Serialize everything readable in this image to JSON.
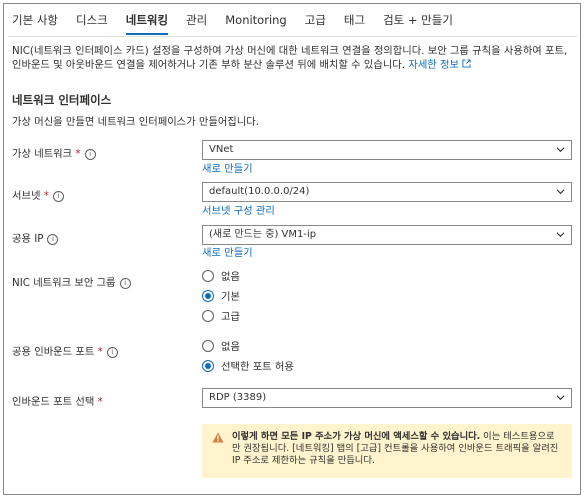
{
  "tabs": [
    "기본 사항",
    "디스크",
    "네트워킹",
    "관리",
    "Monitoring",
    "고급",
    "태그",
    "검토 + 만들기"
  ],
  "active_tab": "네트워킹",
  "description": {
    "text": "NIC(네트워크 인터페이스 카드) 설정을 구성하여 가상 머신에 대한 네트워크 연결을 정의합니다. 보안 그룹 규칙을 사용하여 포트, 인바운드 및 아웃바운드 연결을 제어하거나 기존 부하 분산 솔루션 뒤에 배치할 수 있습니다.",
    "link": "자세한 정보"
  },
  "section": {
    "title": "네트워크 인터페이스",
    "desc": "가상 머신을 만들면 네트워크 인터페이스가 만들어집니다."
  },
  "fields": {
    "vnet": {
      "label": "가상 네트워크",
      "value": "VNet",
      "link": "새로 만들기"
    },
    "subnet": {
      "label": "서브넷",
      "value": "default(10.0.0.0/24)",
      "link": "서브넷 구성 관리"
    },
    "public_ip": {
      "label": "공용 IP",
      "value": "(새로 만드는 중) VM1-ip",
      "link": "새로 만들기"
    },
    "nsg": {
      "label": "NIC 네트워크 보안 그룹",
      "options": [
        "없음",
        "기본",
        "고급"
      ],
      "selected": "기본"
    },
    "inbound_ports": {
      "label": "공용 인바운드 포트",
      "options": [
        "없음",
        "선택한 포트 허용"
      ],
      "selected": "선택한 포트 허용"
    },
    "select_ports": {
      "label": "인바운드 포트 선택",
      "value": "RDP (3389)"
    }
  },
  "required_mark": "*",
  "warning": {
    "bold": "이렇게 하면 모든 IP 주소가 가상 머신에 액세스할 수 있습니다.",
    "text": " 이는 테스트용으로만 권장됩니다. [네트워킹] 탭의 [고급] 컨트롤을 사용하여 인바운드 트래픽을 알려진 IP 주소로 제한하는 규칙을 만듭니다."
  },
  "colors": {
    "accent": "#0f6cbd",
    "required": "#a4262c",
    "warning_bg": "#fff4ce",
    "warning_icon": "#d67f3c"
  }
}
